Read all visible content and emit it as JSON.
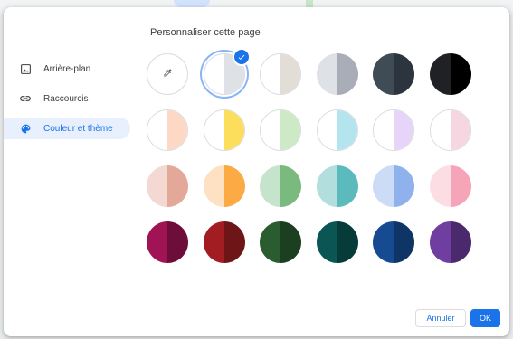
{
  "dialog": {
    "title": "Personnaliser cette page",
    "nav": [
      {
        "label": "Arrière-plan",
        "icon": "image-icon",
        "active": false
      },
      {
        "label": "Raccourcis",
        "icon": "link-icon",
        "active": false
      },
      {
        "label": "Couleur et thème",
        "icon": "palette-icon",
        "active": true
      }
    ],
    "buttons": {
      "cancel": "Annuler",
      "ok": "OK"
    },
    "accent_color": "#1a73e8",
    "themes": [
      {
        "name": "custom",
        "icon": "eyedropper-icon",
        "left": "#ffffff",
        "right": "#ffffff"
      },
      {
        "name": "default",
        "left": "#ffffff",
        "right": "#dee1e6",
        "selected": true
      },
      {
        "name": "warm-grey",
        "left": "#ffffff",
        "right": "#e3ddd8"
      },
      {
        "name": "cool-grey",
        "left": "#dee1e6",
        "right": "#a8adb7"
      },
      {
        "name": "dark-blue-grey",
        "left": "#3f4b55",
        "right": "#2c353d"
      },
      {
        "name": "black",
        "left": "#202124",
        "right": "#000000"
      },
      {
        "name": "peach",
        "left": "#ffffff",
        "right": "#fdd8c4"
      },
      {
        "name": "yellow",
        "left": "#ffffff",
        "right": "#fddd5c"
      },
      {
        "name": "light-green",
        "left": "#ffffff",
        "right": "#cde9c5"
      },
      {
        "name": "light-cyan",
        "left": "#ffffff",
        "right": "#b4e5ef"
      },
      {
        "name": "light-lavender",
        "left": "#ffffff",
        "right": "#e6d5f8"
      },
      {
        "name": "light-pink",
        "left": "#ffffff",
        "right": "#f6d6e1"
      },
      {
        "name": "dusty-rose",
        "left": "#f3d9d1",
        "right": "#e3a898"
      },
      {
        "name": "orange",
        "left": "#fde1c2",
        "right": "#fbaa44"
      },
      {
        "name": "green",
        "left": "#c6e4cb",
        "right": "#7bba7e"
      },
      {
        "name": "teal",
        "left": "#b3dede",
        "right": "#5bbabc"
      },
      {
        "name": "blue",
        "left": "#cddcf6",
        "right": "#8fb2ec"
      },
      {
        "name": "pink",
        "left": "#fcdde3",
        "right": "#f6a5b8"
      },
      {
        "name": "magenta",
        "left": "#a01455",
        "right": "#6d0d39"
      },
      {
        "name": "dark-red",
        "left": "#a11d21",
        "right": "#6e1518"
      },
      {
        "name": "dark-green",
        "left": "#2a5c2f",
        "right": "#1d3f21"
      },
      {
        "name": "dark-teal",
        "left": "#0b5554",
        "right": "#073b3a"
      },
      {
        "name": "dark-blue",
        "left": "#174b91",
        "right": "#0f3466"
      },
      {
        "name": "purple",
        "left": "#6f3ea0",
        "right": "#4a2a6c"
      }
    ]
  }
}
